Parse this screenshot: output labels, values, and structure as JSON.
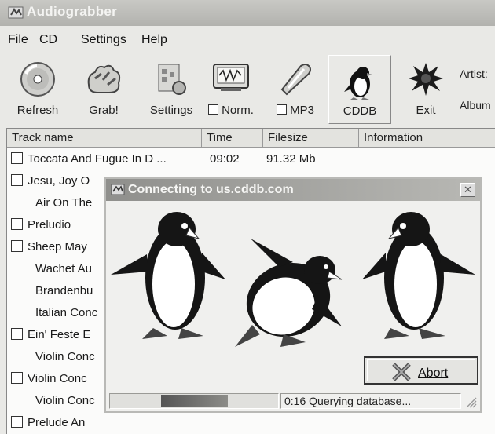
{
  "window": {
    "title": "Audiograbber"
  },
  "menu": [
    "File",
    "CD",
    "Settings",
    "Help"
  ],
  "toolbar": {
    "refresh": "Refresh",
    "grab": "Grab!",
    "settings": "Settings",
    "norm": "Norm.",
    "mp3": "MP3",
    "cddb": "CDDB",
    "exit": "Exit",
    "artist_label": "Artist:",
    "album_label": "Album"
  },
  "columns": {
    "name": "Track name",
    "time": "Time",
    "size": "Filesize",
    "info": "Information"
  },
  "tracks": [
    {
      "name": "Toccata And Fugue In D ...",
      "time": "09:02",
      "size": "91.32 Mb",
      "checked": false,
      "indent": false
    },
    {
      "name": "Jesu, Joy O",
      "time": "",
      "size": "",
      "checked": false,
      "indent": false
    },
    {
      "name": "Air On The",
      "time": "",
      "size": "",
      "checked": false,
      "indent": true
    },
    {
      "name": "Preludio",
      "time": "",
      "size": "",
      "checked": false,
      "indent": false
    },
    {
      "name": "Sheep May",
      "time": "",
      "size": "",
      "checked": false,
      "indent": false
    },
    {
      "name": "Wachet Au",
      "time": "",
      "size": "",
      "checked": false,
      "indent": true
    },
    {
      "name": "Brandenbu",
      "time": "",
      "size": "",
      "checked": false,
      "indent": true
    },
    {
      "name": "Italian Conc",
      "time": "",
      "size": "",
      "checked": false,
      "indent": true
    },
    {
      "name": "Ein' Feste E",
      "time": "",
      "size": "",
      "checked": false,
      "indent": false
    },
    {
      "name": "Violin Conc",
      "time": "",
      "size": "",
      "checked": false,
      "indent": true
    },
    {
      "name": "Violin Conc",
      "time": "",
      "size": "",
      "checked": false,
      "indent": false
    },
    {
      "name": "Violin Conc",
      "time": "",
      "size": "",
      "checked": false,
      "indent": true
    },
    {
      "name": "Prelude An",
      "time": "",
      "size": "",
      "checked": false,
      "indent": false
    }
  ],
  "dialog": {
    "title": "Connecting to us.cddb.com",
    "abort": "Abort",
    "status": "0:16 Querying database...",
    "progress": 0.4
  }
}
